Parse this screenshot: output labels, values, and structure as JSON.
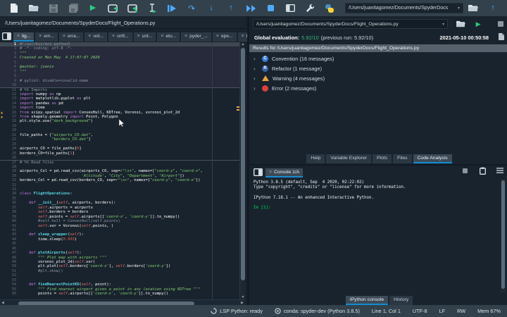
{
  "toolbar": {
    "cwd_path": "/Users/juanitagomez/Documents/SpyderDocs"
  },
  "editor": {
    "path": "/Users/juanitagomez/Documents/SpyderDocs/Flight_Operations.py",
    "tabs": [
      {
        "label": "lig...",
        "active": true
      },
      {
        "label": "em...",
        "active": false
      },
      {
        "label": "erra...",
        "active": false
      },
      {
        "label": "oot...",
        "active": false
      },
      {
        "label": "onft...",
        "active": false
      },
      {
        "label": "unt...",
        "active": false
      },
      {
        "label": "etu...",
        "active": false
      },
      {
        "label": "pyder_...",
        "active": false
      },
      {
        "label": "epe...",
        "active": false
      },
      {
        "label": "the...",
        "active": false
      }
    ],
    "current_cell_end": 10,
    "lines": [
      {
        "n": 1,
        "t": [
          [
            "cm",
            "#!/usr/bin/env python3"
          ]
        ]
      },
      {
        "n": 2,
        "t": [
          [
            "cm",
            "# -*- coding: utf-8 -*-"
          ]
        ]
      },
      {
        "n": 3,
        "t": [
          [
            "st",
            "\"\"\""
          ]
        ]
      },
      {
        "n": 4,
        "t": [
          [
            "st",
            "Created on Mon May  4 17:07:07 2020"
          ]
        ]
      },
      {
        "n": 5,
        "t": []
      },
      {
        "n": 6,
        "t": [
          [
            "st",
            "@author: juanis"
          ]
        ]
      },
      {
        "n": 7,
        "t": [
          [
            "st",
            "\"\"\""
          ]
        ]
      },
      {
        "n": 8,
        "t": []
      },
      {
        "n": 9,
        "t": [
          [
            "cm",
            "# pylint: disable=invalid-name"
          ]
        ]
      },
      {
        "n": 10,
        "t": []
      },
      {
        "n": 11,
        "cell": true,
        "t": [
          [
            "cm",
            "# %% Imports"
          ]
        ]
      },
      {
        "n": 12,
        "t": [
          [
            "kw",
            "import"
          ],
          [
            "tx",
            " numpy "
          ],
          [
            "kw",
            "as"
          ],
          [
            "tx",
            " np"
          ]
        ]
      },
      {
        "n": 13,
        "t": [
          [
            "kw",
            "import"
          ],
          [
            "tx",
            " matplotlib.pyplot "
          ],
          [
            "kw",
            "as"
          ],
          [
            "tx",
            " plt"
          ]
        ]
      },
      {
        "n": 14,
        "t": [
          [
            "kw",
            "import"
          ],
          [
            "tx",
            " pandas "
          ],
          [
            "kw",
            "as"
          ],
          [
            "tx",
            " pd"
          ]
        ]
      },
      {
        "n": 15,
        "t": [
          [
            "kw",
            "import"
          ],
          [
            "tx",
            " time"
          ]
        ]
      },
      {
        "n": 16,
        "w": true,
        "t": [
          [
            "kw",
            "from"
          ],
          [
            "tx",
            " scipy.spatial "
          ],
          [
            "kw",
            "import"
          ],
          [
            "tx",
            " ConvexHull, KDTree, Voronoi, voronoi_plot_2d"
          ]
        ]
      },
      {
        "n": 17,
        "w": true,
        "t": [
          [
            "kw",
            "from"
          ],
          [
            "tx",
            " shapely.geometry "
          ],
          [
            "kw",
            "import"
          ],
          [
            "tx",
            " Point, Polygon"
          ]
        ]
      },
      {
        "n": 18,
        "t": [
          [
            "tx",
            "plt.style.use("
          ],
          [
            "st",
            "\"dark_background\""
          ],
          [
            "tx",
            ")"
          ]
        ]
      },
      {
        "n": 19,
        "t": []
      },
      {
        "n": 20,
        "t": []
      },
      {
        "n": 21,
        "t": [
          [
            "tx",
            "file_paths = ["
          ],
          [
            "st",
            "\"airports_CO.dat\""
          ],
          [
            "tx",
            ","
          ]
        ]
      },
      {
        "n": 22,
        "t": [
          [
            "tx",
            "              "
          ],
          [
            "st",
            "\"borders_CO.dat\""
          ],
          [
            "tx",
            "]"
          ]
        ]
      },
      {
        "n": 23,
        "t": []
      },
      {
        "n": 24,
        "t": [
          [
            "tx",
            "airports_CO = file_paths["
          ],
          [
            "nm",
            "0"
          ],
          [
            "tx",
            "]"
          ]
        ]
      },
      {
        "n": 25,
        "t": [
          [
            "tx",
            "borders_CO=file_paths["
          ],
          [
            "nm",
            "1"
          ],
          [
            "tx",
            "]"
          ]
        ]
      },
      {
        "n": 26,
        "t": []
      },
      {
        "n": 27,
        "cell": true,
        "t": [
          [
            "cm",
            "# %% Read files"
          ]
        ]
      },
      {
        "n": 28,
        "t": []
      },
      {
        "n": 29,
        "t": [
          [
            "tx",
            "airports_Col = pd.read_csv(airports_CO, sep="
          ],
          [
            "st",
            "r\"\\s+\""
          ],
          [
            "tx",
            ", names=["
          ],
          [
            "st",
            "\"coord-y\""
          ],
          [
            "tx",
            ", "
          ],
          [
            "st",
            "\"coord-x\""
          ],
          [
            "tx",
            ","
          ]
        ]
      },
      {
        "n": 30,
        "t": [
          [
            "tx",
            "                           "
          ],
          [
            "st",
            "'Altitude'"
          ],
          [
            "tx",
            ", "
          ],
          [
            "st",
            "\"City\""
          ],
          [
            "tx",
            ", "
          ],
          [
            "st",
            "\"Department\""
          ],
          [
            "tx",
            ", "
          ],
          [
            "st",
            "\"Airport\""
          ],
          [
            "tx",
            "])"
          ]
        ]
      },
      {
        "n": 31,
        "t": [
          [
            "tx",
            "borders_Col = pd.read_csv(borders_CO, sep="
          ],
          [
            "st",
            "r\"\\s+\""
          ],
          [
            "tx",
            ", names=["
          ],
          [
            "st",
            "\"coord-y\""
          ],
          [
            "tx",
            ", "
          ],
          [
            "st",
            "\"coord-x\""
          ],
          [
            "tx",
            "])"
          ]
        ]
      },
      {
        "n": 32,
        "t": []
      },
      {
        "n": 33,
        "t": []
      },
      {
        "n": 34,
        "t": [
          [
            "kw",
            "class"
          ],
          [
            "tx",
            " "
          ],
          [
            "df",
            "FlightOperations"
          ],
          [
            "tx",
            ":"
          ]
        ]
      },
      {
        "n": 35,
        "t": []
      },
      {
        "n": 36,
        "t": [
          [
            "tx",
            "    "
          ],
          [
            "kw",
            "def"
          ],
          [
            "tx",
            " "
          ],
          [
            "df",
            "__init__"
          ],
          [
            "tx",
            "("
          ],
          [
            "sf",
            "self"
          ],
          [
            "tx",
            ", airports, borders):"
          ]
        ]
      },
      {
        "n": 37,
        "t": [
          [
            "tx",
            "        "
          ],
          [
            "sf",
            "self"
          ],
          [
            "tx",
            ".airports = airports"
          ]
        ]
      },
      {
        "n": 38,
        "t": [
          [
            "tx",
            "        "
          ],
          [
            "sf",
            "self"
          ],
          [
            "tx",
            ".borders = borders"
          ]
        ]
      },
      {
        "n": 39,
        "t": [
          [
            "tx",
            "        "
          ],
          [
            "sf",
            "self"
          ],
          [
            "tx",
            ".points = "
          ],
          [
            "sf",
            "self"
          ],
          [
            "tx",
            ".airports[["
          ],
          [
            "st",
            "'coord-x'"
          ],
          [
            "tx",
            ", "
          ],
          [
            "st",
            "'coord-y'"
          ],
          [
            "tx",
            "]].to_numpy()"
          ]
        ]
      },
      {
        "n": 40,
        "t": [
          [
            "cm",
            "        #self.hull = ConvexHull(self.points)"
          ]
        ]
      },
      {
        "n": 41,
        "t": [
          [
            "tx",
            "        "
          ],
          [
            "sf",
            "self"
          ],
          [
            "tx",
            ".vor = Voronoi("
          ],
          [
            "sf",
            "self"
          ],
          [
            "tx",
            ".points, )"
          ]
        ]
      },
      {
        "n": 42,
        "t": []
      },
      {
        "n": 43,
        "t": [
          [
            "tx",
            "    "
          ],
          [
            "kw",
            "def"
          ],
          [
            "tx",
            " "
          ],
          [
            "df",
            "sleep_wrapper"
          ],
          [
            "tx",
            "("
          ],
          [
            "sf",
            "self"
          ],
          [
            "tx",
            "):"
          ]
        ]
      },
      {
        "n": 44,
        "t": [
          [
            "tx",
            "        time.sleep("
          ],
          [
            "nm",
            "0.003"
          ],
          [
            "tx",
            ")"
          ]
        ]
      },
      {
        "n": 45,
        "t": []
      },
      {
        "n": 46,
        "t": []
      },
      {
        "n": 47,
        "t": [
          [
            "tx",
            "    "
          ],
          [
            "kw",
            "def"
          ],
          [
            "tx",
            " "
          ],
          [
            "df",
            "plotAirports"
          ],
          [
            "tx",
            "("
          ],
          [
            "sf",
            "self"
          ],
          [
            "tx",
            "):"
          ]
        ]
      },
      {
        "n": 48,
        "t": [
          [
            "tx",
            "        "
          ],
          [
            "st",
            "\"\"\" Plot map with airports \"\"\""
          ]
        ]
      },
      {
        "n": 49,
        "t": [
          [
            "tx",
            "        voronoi_plot_2d("
          ],
          [
            "sf",
            "self"
          ],
          [
            "tx",
            ".vor)"
          ]
        ]
      },
      {
        "n": 50,
        "t": [
          [
            "tx",
            "        plt.plot("
          ],
          [
            "sf",
            "self"
          ],
          [
            "tx",
            ".borders["
          ],
          [
            "st",
            "'coord-x'"
          ],
          [
            "tx",
            "], "
          ],
          [
            "sf",
            "self"
          ],
          [
            "tx",
            ".borders["
          ],
          [
            "st",
            "'coord-y'"
          ],
          [
            "tx",
            "])"
          ]
        ]
      },
      {
        "n": 51,
        "t": [
          [
            "cm",
            "        #plt.show()"
          ]
        ]
      },
      {
        "n": 52,
        "t": []
      },
      {
        "n": 53,
        "t": []
      },
      {
        "n": 54,
        "t": [
          [
            "tx",
            "    "
          ],
          [
            "kw",
            "def"
          ],
          [
            "tx",
            " "
          ],
          [
            "df",
            "findNearestPointKD"
          ],
          [
            "tx",
            "("
          ],
          [
            "sf",
            "self"
          ],
          [
            "tx",
            ", point):"
          ]
        ]
      },
      {
        "n": 55,
        "t": [
          [
            "tx",
            "        "
          ],
          [
            "st",
            "\"\"\" Find nearest airport given a point in any location using KDTree \"\"\""
          ]
        ]
      },
      {
        "n": 56,
        "t": [
          [
            "tx",
            "        points = "
          ],
          [
            "sf",
            "self"
          ],
          [
            "tx",
            ".airports[["
          ],
          [
            "st",
            "'coord-x'"
          ],
          [
            "tx",
            ", "
          ],
          [
            "st",
            "'coord-y'"
          ],
          [
            "tx",
            "]].to_numpy()"
          ]
        ]
      }
    ]
  },
  "analysis": {
    "path_value": "/Users/juanitagomez/Documents/SpyderDocs/Flight_Operations.py",
    "eval_label": "Global evaluation:",
    "score": "5.92/10",
    "previous": "(previous run: 5.92/10)",
    "datetime": "2021-05-10 00:50:58",
    "results_header": "Results for /Users/juanitagomez/Documents/SpyderDocs/Flight_Operations.py",
    "items": [
      {
        "badge": "C",
        "shape": "circle",
        "color": "#3b7dd8",
        "label": "Convention (16 messages)"
      },
      {
        "badge": "R",
        "shape": "circle",
        "color": "#3465a8",
        "label": "Refactor (1 message)"
      },
      {
        "badge": "",
        "shape": "triangle",
        "color": "#e8a33d",
        "label": "Warning (4 messages)"
      },
      {
        "badge": "",
        "shape": "circle",
        "color": "#d8413c",
        "label": "Error (2 messages)"
      }
    ],
    "tabs": [
      {
        "label": "Help",
        "active": false
      },
      {
        "label": "Variable Explorer",
        "active": false
      },
      {
        "label": "Plots",
        "active": false
      },
      {
        "label": "Files",
        "active": false
      },
      {
        "label": "Code Analysis",
        "active": true
      }
    ]
  },
  "console": {
    "tab_label": "Console 1/A",
    "lines": [
      "Python 3.8.5 (default, Sep  4 2020, 02:22:02)",
      "Type \"copyright\", \"credits\" or \"license\" for more information.",
      "",
      "IPython 7.18.1 -- An enhanced Interactive Python.",
      ""
    ],
    "prompt": "In [1]:",
    "tabs": [
      {
        "label": "IPython console",
        "active": true
      },
      {
        "label": "History",
        "active": false
      }
    ]
  },
  "statusbar": {
    "lsp": "LSP Python: ready",
    "conda": "conda: spyder-dev (Python 3.8.5)",
    "cursor_pos": "Line 1, Col 1",
    "encoding": "UTF-8",
    "eol": "LF",
    "permissions": "RW",
    "memory": "Mem 67%"
  }
}
